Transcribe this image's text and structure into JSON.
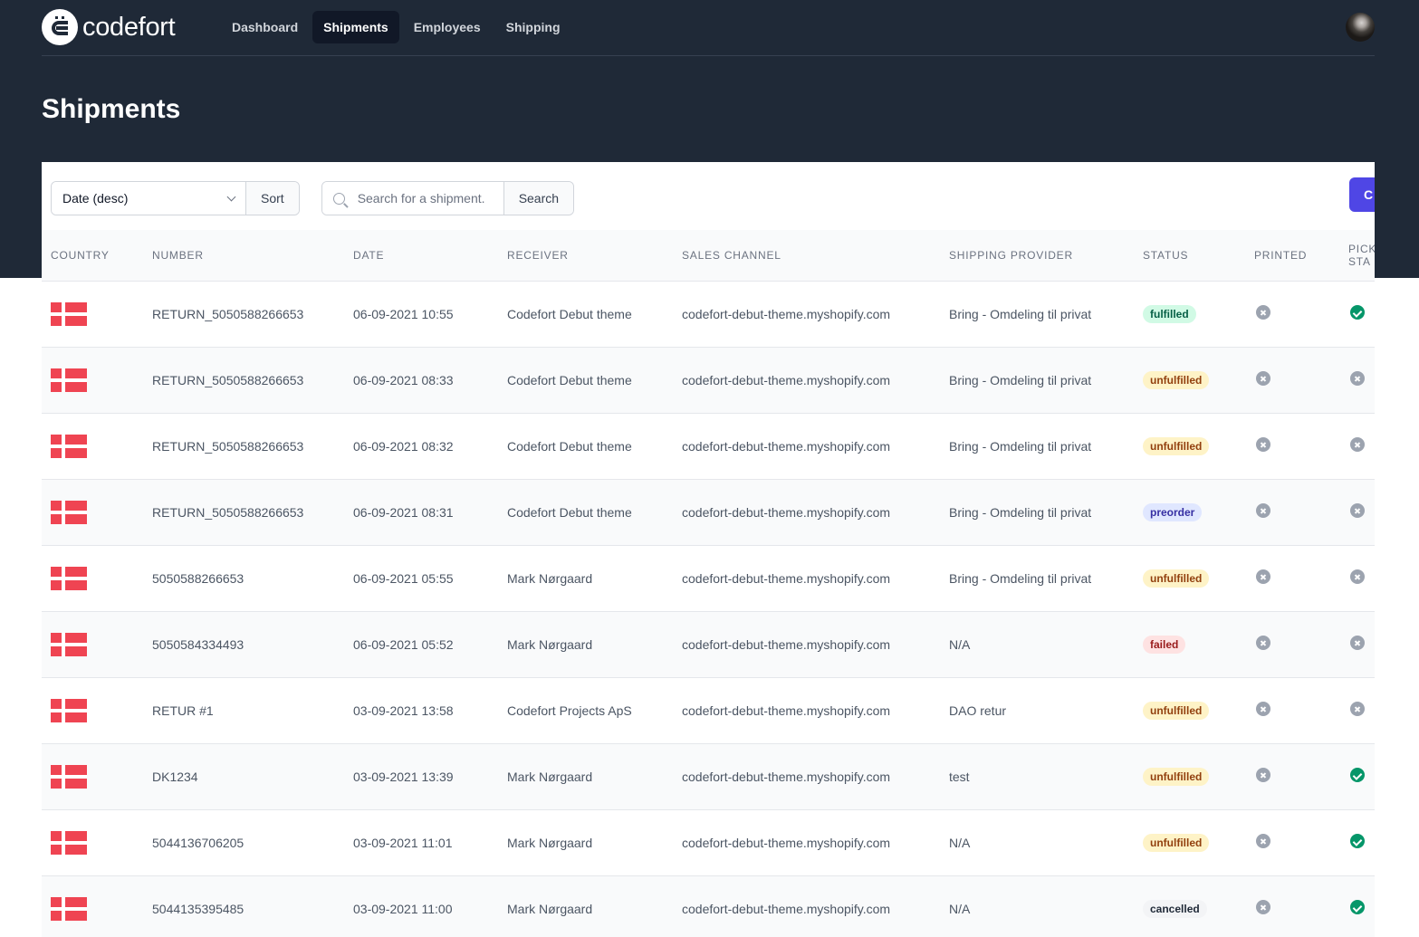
{
  "app": {
    "brand": "codefort"
  },
  "nav": {
    "items": [
      {
        "label": "Dashboard",
        "active": false
      },
      {
        "label": "Shipments",
        "active": true
      },
      {
        "label": "Employees",
        "active": false
      },
      {
        "label": "Shipping",
        "active": false
      }
    ]
  },
  "page": {
    "title": "Shipments"
  },
  "toolbar": {
    "sort_value": "Date (desc)",
    "sort_label": "Sort",
    "search_placeholder": "Search for a shipment.",
    "search_label": "Search",
    "create_label": "C"
  },
  "table": {
    "headers": [
      "Country",
      "Number",
      "Date",
      "Receiver",
      "Sales channel",
      "Shipping provider",
      "Status",
      "Printed",
      "Pick sta"
    ],
    "rows": [
      {
        "country": "DK",
        "number": "RETURN_5050588266653",
        "date": "06-09-2021 10:55",
        "receiver": "Codefort Debut theme",
        "channel": "codefort-debut-theme.myshopify.com",
        "provider": "Bring - Omdeling til privat",
        "status": "fulfilled",
        "printed": false,
        "picked": true
      },
      {
        "country": "DK",
        "number": "RETURN_5050588266653",
        "date": "06-09-2021 08:33",
        "receiver": "Codefort Debut theme",
        "channel": "codefort-debut-theme.myshopify.com",
        "provider": "Bring - Omdeling til privat",
        "status": "unfulfilled",
        "printed": false,
        "picked": false
      },
      {
        "country": "DK",
        "number": "RETURN_5050588266653",
        "date": "06-09-2021 08:32",
        "receiver": "Codefort Debut theme",
        "channel": "codefort-debut-theme.myshopify.com",
        "provider": "Bring - Omdeling til privat",
        "status": "unfulfilled",
        "printed": false,
        "picked": false
      },
      {
        "country": "DK",
        "number": "RETURN_5050588266653",
        "date": "06-09-2021 08:31",
        "receiver": "Codefort Debut theme",
        "channel": "codefort-debut-theme.myshopify.com",
        "provider": "Bring - Omdeling til privat",
        "status": "preorder",
        "printed": false,
        "picked": false
      },
      {
        "country": "DK",
        "number": "5050588266653",
        "date": "06-09-2021 05:55",
        "receiver": "Mark Nørgaard",
        "channel": "codefort-debut-theme.myshopify.com",
        "provider": "Bring - Omdeling til privat",
        "status": "unfulfilled",
        "printed": false,
        "picked": false
      },
      {
        "country": "DK",
        "number": "5050584334493",
        "date": "06-09-2021 05:52",
        "receiver": "Mark Nørgaard",
        "channel": "codefort-debut-theme.myshopify.com",
        "provider": "N/A",
        "status": "failed",
        "printed": false,
        "picked": false
      },
      {
        "country": "DK",
        "number": "RETUR #1",
        "date": "03-09-2021 13:58",
        "receiver": "Codefort Projects ApS",
        "channel": "codefort-debut-theme.myshopify.com",
        "provider": "DAO retur",
        "status": "unfulfilled",
        "printed": false,
        "picked": false
      },
      {
        "country": "DK",
        "number": "DK1234",
        "date": "03-09-2021 13:39",
        "receiver": "Mark Nørgaard",
        "channel": "codefort-debut-theme.myshopify.com",
        "provider": "test",
        "status": "unfulfilled",
        "printed": false,
        "picked": true
      },
      {
        "country": "DK",
        "number": "5044136706205",
        "date": "03-09-2021 11:01",
        "receiver": "Mark Nørgaard",
        "channel": "codefort-debut-theme.myshopify.com",
        "provider": "N/A",
        "status": "unfulfilled",
        "printed": false,
        "picked": true
      },
      {
        "country": "DK",
        "number": "5044135395485",
        "date": "03-09-2021 11:00",
        "receiver": "Mark Nørgaard",
        "channel": "codefort-debut-theme.myshopify.com",
        "provider": "N/A",
        "status": "cancelled",
        "printed": false,
        "picked": true
      }
    ]
  },
  "colors": {
    "header_bg": "#1f2937",
    "accent": "#4f46e5",
    "flag_red": "#ef4452",
    "check_green": "#059669"
  }
}
